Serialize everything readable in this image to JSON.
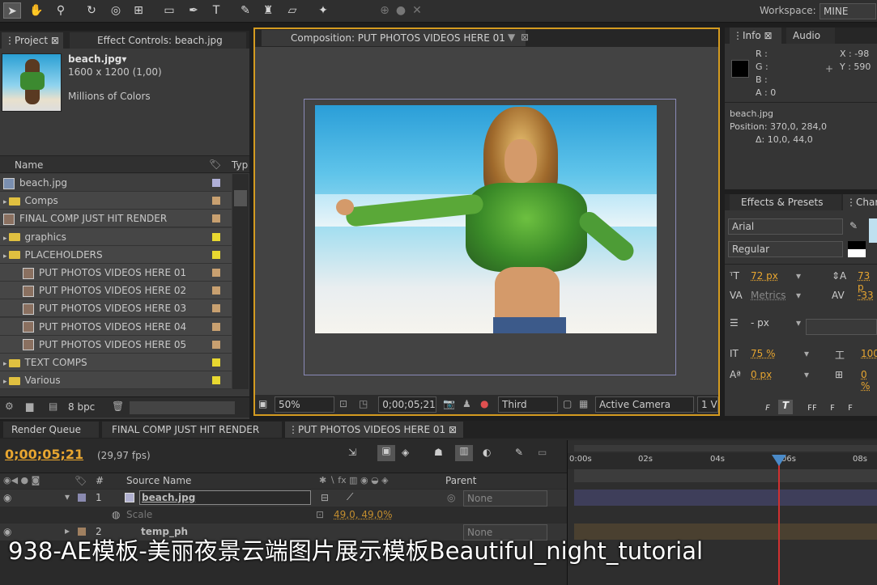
{
  "workspace": {
    "label": "Workspace:",
    "value": "MINE"
  },
  "project_panel": {
    "tabs": [
      "Project",
      "Effect Controls: beach.jpg"
    ],
    "selected_name": "beach.jpg▾",
    "selected_size": "1600 x 1200 (1,00)",
    "selected_colors": "Millions of Colors",
    "col_name": "Name",
    "col_type": "Typ",
    "items": [
      {
        "label": "beach.jpg",
        "kind": "file",
        "color": "#b0b0d8",
        "indent": 0
      },
      {
        "label": "Comps",
        "kind": "folder",
        "color": "#c8a070",
        "indent": 0
      },
      {
        "label": "FINAL COMP JUST HIT RENDER",
        "kind": "comp",
        "color": "#c8a070",
        "indent": 0
      },
      {
        "label": "graphics",
        "kind": "folder",
        "color": "#e8d830",
        "indent": 0
      },
      {
        "label": "PLACEHOLDERS",
        "kind": "folder",
        "color": "#e8d830",
        "indent": 0
      },
      {
        "label": "PUT PHOTOS VIDEOS HERE 01",
        "kind": "comp",
        "color": "#c8a070",
        "indent": 1
      },
      {
        "label": "PUT PHOTOS VIDEOS HERE 02",
        "kind": "comp",
        "color": "#c8a070",
        "indent": 1
      },
      {
        "label": "PUT PHOTOS VIDEOS HERE 03",
        "kind": "comp",
        "color": "#c8a070",
        "indent": 1
      },
      {
        "label": "PUT PHOTOS VIDEOS HERE 04",
        "kind": "comp",
        "color": "#c8a070",
        "indent": 1
      },
      {
        "label": "PUT PHOTOS VIDEOS HERE 05",
        "kind": "comp",
        "color": "#c8a070",
        "indent": 1
      },
      {
        "label": "TEXT COMPS",
        "kind": "folder",
        "color": "#e8d830",
        "indent": 0
      },
      {
        "label": "Various",
        "kind": "folder",
        "color": "#e8d830",
        "indent": 0
      }
    ],
    "bpc": "8 bpc"
  },
  "composition_panel": {
    "tab": "Composition: PUT PHOTOS VIDEOS HERE 01",
    "zoom": "50%",
    "timecode": "0;00;05;21",
    "resolution": "Third",
    "camera": "Active Camera",
    "views": "1 Vie"
  },
  "info_panel": {
    "tabs": [
      "Info",
      "Audio"
    ],
    "r": "R :",
    "g": "G :",
    "b": "B :",
    "a": "A : 0",
    "x": "X : -98",
    "y": "Y : 590",
    "file": "beach.jpg",
    "position": "Position: 370,0, 284,0",
    "delta": "Δ: 10,0, 44,0"
  },
  "character_panel": {
    "tabs": [
      "Effects & Presets",
      "Chara"
    ],
    "font": "Arial",
    "style": "Regular",
    "font_size": "72 px",
    "leading": "73 p",
    "kerning": "Metrics",
    "tracking": "-33",
    "stroke": "- px",
    "vscale": "75 %",
    "hscale": "100",
    "baseline": "0 px",
    "tsume": "0 %"
  },
  "timeline": {
    "tabs": [
      "Render Queue",
      "FINAL COMP JUST HIT RENDER",
      "PUT PHOTOS VIDEOS HERE 01"
    ],
    "timecode": "0;00;05;21",
    "fps": "(29,97 fps)",
    "col_num": "#",
    "col_source": "Source Name",
    "col_parent": "Parent",
    "layers": [
      {
        "num": "1",
        "name": "beach.jpg",
        "parent": "None"
      },
      {
        "num": "2",
        "name": "temp_ph",
        "parent": "None"
      }
    ],
    "scale_label": "Scale",
    "scale_value": "49,0, 49,0%",
    "ruler": [
      "0:00s",
      "02s",
      "04s",
      "06s",
      "08s"
    ]
  },
  "caption": "938-AE模板-美丽夜景云端图片展示模板Beautiful_night_tutorial"
}
